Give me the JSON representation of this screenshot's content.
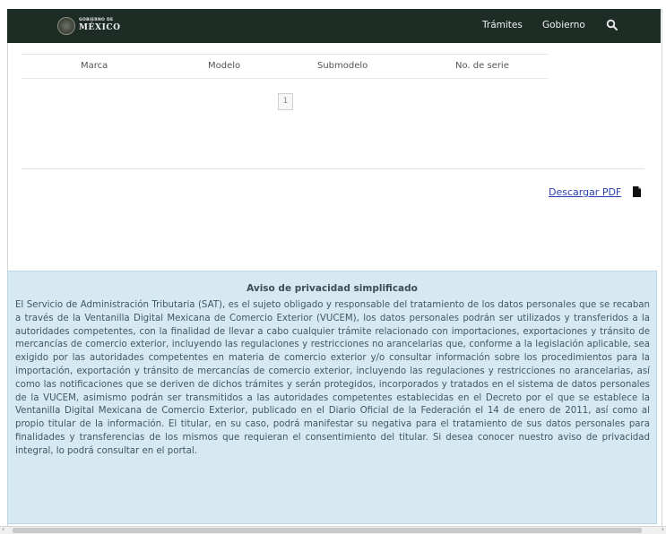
{
  "header": {
    "logo_small": "GOBIERNO DE",
    "logo_big": "MÉXICO",
    "nav": [
      "Trámites",
      "Gobierno"
    ],
    "search_icon": "search-icon",
    "bg_color": "#1e2c26"
  },
  "table": {
    "columns": [
      "Marca",
      "Modelo",
      "Submodelo",
      "No. de serie"
    ],
    "rows": [],
    "pagination": {
      "current_page": "1"
    }
  },
  "download": {
    "label": "Descargar PDF",
    "icon": "file-icon",
    "color": "#2a3eb1"
  },
  "privacy": {
    "title": "Aviso de privacidad simplificado",
    "body": "El Servicio de Administración Tributaria (SAT), es el sujeto obligado y responsable del tratamiento de los datos personales que se recaban a través de la Ventanilla Digital Mexicana de Comercio Exterior (VUCEM), los datos personales podrán ser utilizados y transferidos a la autoridades competentes, con la finalidad de llevar a cabo cualquier trámite relacionado con importaciones, exportaciones y tránsito de mercancías de comercio exterior, incluyendo las regulaciones y restricciones no arancelarias que, conforme a la legislación aplicable, sea exigido por las autoridades competentes en materia de comercio exterior y/o consultar información sobre los procedimientos para la importación, exportación y tránsito de mercancías de comercio exterior, incluyendo las regulaciones y restricciones no arancelarias, así como las notificaciones que se deriven de dichos trámites y serán protegidos, incorporados y tratados en el sistema de datos personales de la VUCEM, asimismo podrán ser transmitidos a las autoridades competentes establecidas en el Decreto por el que se establece la Ventanilla Digital Mexicana de Comercio Exterior, publicado en el Diario Oficial de la Federación el 14 de enero de 2011, así como al propio titular de la información. El titular, en su caso, podrá manifestar su negativa para el tratamiento de sus datos personales para finalidades y transferencias de los mismos que requieran el consentimiento del titular. Si desea conocer nuestro aviso de privacidad integral, lo podrá consultar en el portal.",
    "bg_color": "#d6e8f2"
  },
  "scrollbar": {
    "left_arrow": "‹",
    "right_arrow": "›"
  }
}
